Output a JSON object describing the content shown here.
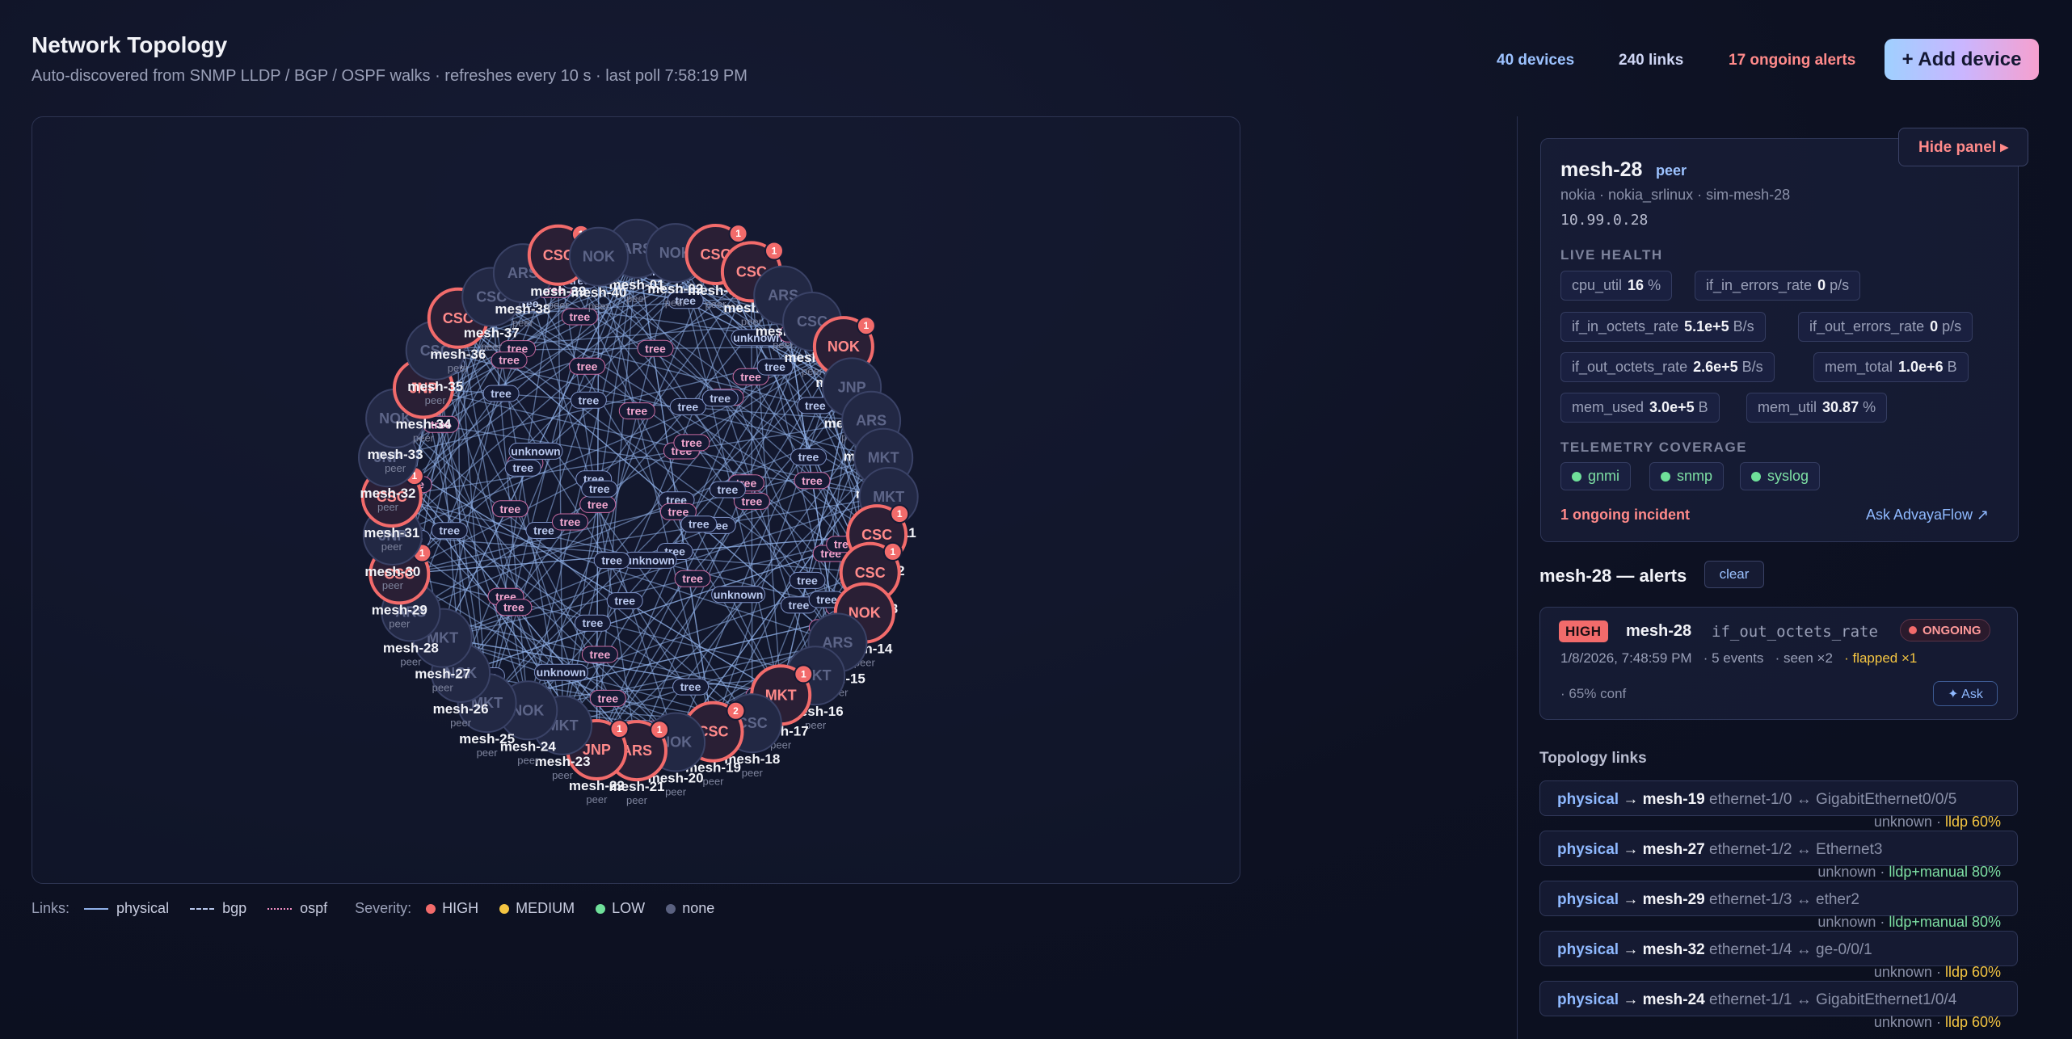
{
  "header": {
    "title": "Network Topology",
    "subtitle": "Auto-discovered from SNMP LLDP / BGP / OSPF walks · refreshes every 10 s · last poll 7:58:19 PM",
    "devices_count": "40 devices",
    "links_count": "240 links",
    "alerts_count": "17 ongoing alerts",
    "add_device_label": "+ Add device"
  },
  "colors": {
    "high": "#f26b6b",
    "medium": "#f4c542",
    "low": "#6fe09a",
    "none": "#5a6180",
    "physical_link": "#8fb0e8",
    "accent": "#9cc2ff"
  },
  "graph": {
    "node_sublabel": "peer",
    "nodes": [
      {
        "name": "mesh-01",
        "vendor": "ARS",
        "sev": "none",
        "alerts": 0
      },
      {
        "name": "mesh-02",
        "vendor": "NOK",
        "sev": "none",
        "alerts": 0
      },
      {
        "name": "mesh-03",
        "vendor": "CSC",
        "sev": "high",
        "alerts": 1
      },
      {
        "name": "mesh-04",
        "vendor": "CSC",
        "sev": "high",
        "alerts": 1
      },
      {
        "name": "mesh-05",
        "vendor": "ARS",
        "sev": "none",
        "alerts": 0
      },
      {
        "name": "mesh-06",
        "vendor": "CSC",
        "sev": "none",
        "alerts": 0
      },
      {
        "name": "mesh-07",
        "vendor": "NOK",
        "sev": "high",
        "alerts": 1
      },
      {
        "name": "mesh-08",
        "vendor": "JNP",
        "sev": "none",
        "alerts": 0
      },
      {
        "name": "mesh-09",
        "vendor": "ARS",
        "sev": "none",
        "alerts": 0
      },
      {
        "name": "mesh-10",
        "vendor": "MKT",
        "sev": "none",
        "alerts": 0
      },
      {
        "name": "mesh-11",
        "vendor": "MKT",
        "sev": "none",
        "alerts": 0
      },
      {
        "name": "mesh-12",
        "vendor": "CSC",
        "sev": "high",
        "alerts": 1
      },
      {
        "name": "mesh-13",
        "vendor": "CSC",
        "sev": "high",
        "alerts": 1
      },
      {
        "name": "mesh-14",
        "vendor": "NOK",
        "sev": "high",
        "alerts": 0
      },
      {
        "name": "mesh-15",
        "vendor": "ARS",
        "sev": "none",
        "alerts": 0
      },
      {
        "name": "mesh-16",
        "vendor": "MKT",
        "sev": "none",
        "alerts": 0
      },
      {
        "name": "mesh-17",
        "vendor": "MKT",
        "sev": "high",
        "alerts": 1
      },
      {
        "name": "mesh-18",
        "vendor": "CSC",
        "sev": "none",
        "alerts": 0
      },
      {
        "name": "mesh-19",
        "vendor": "CSC",
        "sev": "high",
        "alerts": 2
      },
      {
        "name": "mesh-20",
        "vendor": "NOK",
        "sev": "none",
        "alerts": 0
      },
      {
        "name": "mesh-21",
        "vendor": "ARS",
        "sev": "high",
        "alerts": 1
      },
      {
        "name": "mesh-22",
        "vendor": "JNP",
        "sev": "high",
        "alerts": 1
      },
      {
        "name": "mesh-23",
        "vendor": "MKT",
        "sev": "none",
        "alerts": 0
      },
      {
        "name": "mesh-24",
        "vendor": "NOK",
        "sev": "none",
        "alerts": 0
      },
      {
        "name": "mesh-25",
        "vendor": "MKT",
        "sev": "none",
        "alerts": 0
      },
      {
        "name": "mesh-26",
        "vendor": "NOK",
        "sev": "none",
        "alerts": 0
      },
      {
        "name": "mesh-27",
        "vendor": "MKT",
        "sev": "none",
        "alerts": 0
      },
      {
        "name": "mesh-28",
        "vendor": "ARS",
        "sev": "none",
        "alerts": 0
      },
      {
        "name": "mesh-29",
        "vendor": "CSC",
        "sev": "high",
        "alerts": 1
      },
      {
        "name": "mesh-30",
        "vendor": "JNP",
        "sev": "none",
        "alerts": 0
      },
      {
        "name": "mesh-31",
        "vendor": "CSC",
        "sev": "high",
        "alerts": 1
      },
      {
        "name": "mesh-32",
        "vendor": "JNP",
        "sev": "none",
        "alerts": 0
      },
      {
        "name": "mesh-33",
        "vendor": "NOK",
        "sev": "none",
        "alerts": 0
      },
      {
        "name": "mesh-34",
        "vendor": "JNP",
        "sev": "high",
        "alerts": 0
      },
      {
        "name": "mesh-35",
        "vendor": "CSC",
        "sev": "none",
        "alerts": 0
      },
      {
        "name": "mesh-36",
        "vendor": "CSC",
        "sev": "high",
        "alerts": 2
      },
      {
        "name": "mesh-37",
        "vendor": "CSC",
        "sev": "none",
        "alerts": 0
      },
      {
        "name": "mesh-38",
        "vendor": "ARS",
        "sev": "none",
        "alerts": 0
      },
      {
        "name": "mesh-39",
        "vendor": "CSC",
        "sev": "high",
        "alerts": 1
      },
      {
        "name": "mesh-40",
        "vendor": "NOK",
        "sev": "none",
        "alerts": 0
      }
    ],
    "edge_labels": [
      "tree",
      "unknown"
    ]
  },
  "legend": {
    "links_title": "Links:",
    "physical": "physical",
    "bgp": "bgp",
    "ospf": "ospf",
    "severity_title": "Severity:",
    "high": "HIGH",
    "medium": "MEDIUM",
    "low": "LOW",
    "none": "none"
  },
  "panel": {
    "hide_label": "Hide panel ▸",
    "device": {
      "name": "mesh-28",
      "role": "peer",
      "meta": "nokia · nokia_srlinux · sim-mesh-28",
      "ip": "10.99.0.28"
    },
    "live_health_title": "LIVE HEALTH",
    "metrics": [
      {
        "name": "cpu_util",
        "value": "16",
        "unit": "%"
      },
      {
        "name": "if_in_errors_rate",
        "value": "0",
        "unit": "p/s"
      },
      {
        "name": "if_in_octets_rate",
        "value": "5.1e+5",
        "unit": "B/s"
      },
      {
        "name": "if_out_errors_rate",
        "value": "0",
        "unit": "p/s"
      },
      {
        "name": "if_out_octets_rate",
        "value": "2.6e+5",
        "unit": "B/s"
      },
      {
        "name": "mem_total",
        "value": "1.0e+6",
        "unit": "B"
      },
      {
        "name": "mem_used",
        "value": "3.0e+5",
        "unit": "B"
      },
      {
        "name": "mem_util",
        "value": "30.87",
        "unit": "%"
      }
    ],
    "telemetry_title": "TELEMETRY COVERAGE",
    "telemetry": [
      "gnmi",
      "snmp",
      "syslog"
    ],
    "incident_text": "1 ongoing incident",
    "ask_label": "Ask AdvayaFlow ↗",
    "alerts_title": "mesh-28 — alerts",
    "clear_label": "clear",
    "alert": {
      "severity": "HIGH",
      "device": "mesh-28",
      "metric": "if_out_octets_rate",
      "status": "ONGOING",
      "time": "1/8/2026, 7:48:59 PM",
      "events": "· 5 events",
      "seen": "· seen ×2",
      "flapped": "· flapped ×1",
      "confidence": "· 65% conf",
      "ask_label": "✦ Ask"
    },
    "links_title": "Topology links",
    "links": [
      {
        "kind": "physical",
        "peer": "mesh-19",
        "ports": "ethernet-1/0 ↔ GigabitEthernet0/0/5",
        "status": "unknown",
        "source": "lldp 60%",
        "source_color": "amber"
      },
      {
        "kind": "physical",
        "peer": "mesh-27",
        "ports": "ethernet-1/2 ↔ Ethernet3",
        "status": "unknown",
        "source": "lldp+manual 80%",
        "source_color": "green"
      },
      {
        "kind": "physical",
        "peer": "mesh-29",
        "ports": "ethernet-1/3 ↔ ether2",
        "status": "unknown",
        "source": "lldp+manual 80%",
        "source_color": "green"
      },
      {
        "kind": "physical",
        "peer": "mesh-32",
        "ports": "ethernet-1/4 ↔ ge-0/0/1",
        "status": "unknown",
        "source": "lldp 60%",
        "source_color": "amber"
      },
      {
        "kind": "physical",
        "peer": "mesh-24",
        "ports": "ethernet-1/1 ↔ GigabitEthernet1/0/4",
        "status": "unknown",
        "source": "lldp 60%",
        "source_color": "amber"
      }
    ]
  }
}
